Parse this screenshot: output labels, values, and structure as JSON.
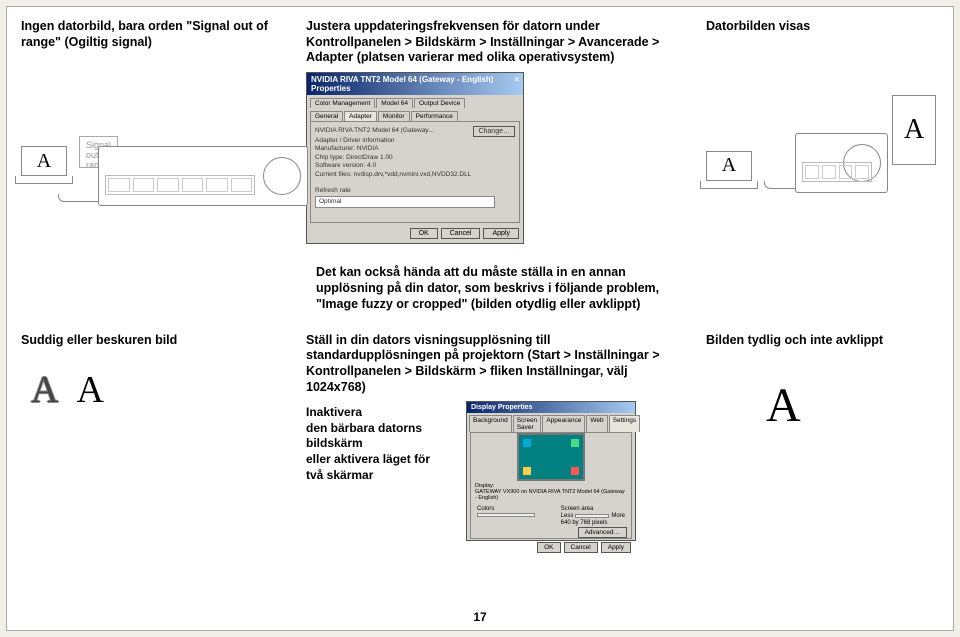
{
  "row1": {
    "left_heading": "Ingen datorbild, bara orden \"Signal out of range\" (Ogiltig signal)",
    "signal_text": "Signal out of range",
    "center_heading": "Justera uppdateringsfrekvensen för datorn under Kontrollpanelen > Bildskärm > Inställningar > Avancerade > Adapter (platsen varierar med olika operativsystem)",
    "right_heading": "Datorbilden visas"
  },
  "dialog1": {
    "title": "NVIDIA RIVA TNT2 Model 64 (Gateway - English) Properties",
    "close": "×",
    "tabs_r1": [
      "Color Management",
      "Model 64",
      "Output Device"
    ],
    "tabs_r2": [
      "General",
      "Adapter",
      "Monitor",
      "Performance"
    ],
    "body_lines": [
      "NVIDIA RIVA TNT2 Model 64 (Gateway…",
      "Adapter / Driver information",
      "Manufacturer:    NVIDIA",
      "Chip type:       DirectDraw 1.00",
      "Software version: 4.0",
      "Current files:   nvdisp.drv,*vdd,nvmini.vxd,NVDD32.DLL",
      "",
      "Refresh rate",
      "Optimal"
    ],
    "change_btn": "Change…",
    "ok": "OK",
    "cancel": "Cancel",
    "apply": "Apply"
  },
  "mid_text": "Det kan också hända att du måste ställa in en annan upplösning på din dator, som beskrivs i följande problem, \"Image fuzzy or cropped\" (bilden otydlig eller avklippt)",
  "row3": {
    "left_heading": "Suddig eller beskuren bild",
    "center_heading": "Ställ in din dators visningsupplösning till standardupplösningen på projektorn (Start > Inställningar > Kontrollpanelen > Bildskärm > fliken Inställningar, välj 1024x768)",
    "inaktivera": "Inaktivera\nden bärbara datorns bildskärm\neller aktivera läget för två skärmar",
    "right_heading": "Bilden tydlig och inte avklippt"
  },
  "dialog2": {
    "title": "Display Properties",
    "tabs": [
      "Background",
      "Screen Saver",
      "Appearance",
      "Web",
      "Settings"
    ],
    "display_label": "Display:",
    "display_value": "GATEWAY VX900 on NVIDIA RIVA TNT2 Model 64 (Gateway - English)",
    "colors_label": "Colors",
    "area_label": "Screen area",
    "less": "Less",
    "more": "More",
    "res": "640 by 768 pixels",
    "adv": "Advanced…",
    "ok": "OK",
    "cancel": "Cancel",
    "apply": "Apply"
  },
  "letter_A": "A",
  "page_number": "17"
}
